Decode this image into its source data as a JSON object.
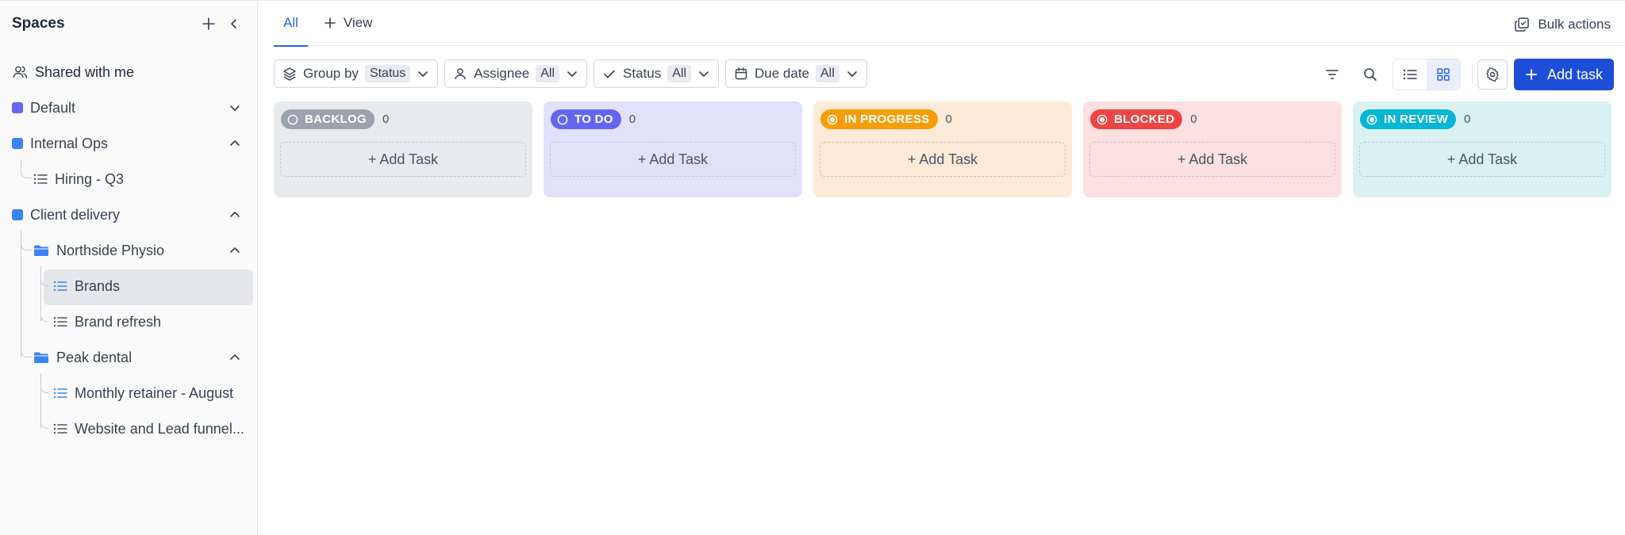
{
  "sidebar": {
    "title": "Spaces",
    "shared": "Shared with me",
    "spaces": [
      {
        "label": "Default",
        "color": "#6366f1"
      },
      {
        "label": "Internal Ops",
        "color": "#3b82f6"
      },
      {
        "label": "Client delivery",
        "color": "#3b82f6"
      }
    ],
    "hiring": "Hiring - Q3",
    "northside": "Northside Physio",
    "brands": "Brands",
    "brand_refresh": "Brand refresh",
    "peak": "Peak dental",
    "monthly": "Monthly retainer - August",
    "website": "Website and Lead funnel..."
  },
  "tabs": {
    "all": "All",
    "view": "View"
  },
  "bulk_actions": "Bulk actions",
  "filters": {
    "group_by": "Group by",
    "group_by_value": "Status",
    "assignee": "Assignee",
    "assignee_value": "All",
    "status": "Status",
    "status_value": "All",
    "due_date": "Due date",
    "due_date_value": "All"
  },
  "add_task": "Add task",
  "columns": [
    {
      "label": "BACKLOG",
      "count": "0",
      "add": "+ Add Task",
      "color": "#9ca3af",
      "bg": "#e8ebee"
    },
    {
      "label": "TO DO",
      "count": "0",
      "add": "+ Add Task",
      "color": "#6366f1",
      "bg": "#e2e1fb"
    },
    {
      "label": "IN PROGRESS",
      "count": "0",
      "add": "+ Add Task",
      "color": "#f59e0b",
      "bg": "#fdebd7"
    },
    {
      "label": "BLOCKED",
      "count": "0",
      "add": "+ Add Task",
      "color": "#ef4444",
      "bg": "#fde0e0"
    },
    {
      "label": "IN REVIEW",
      "count": "0",
      "add": "+ Add Task",
      "color": "#06b6d4",
      "bg": "#daf1f4"
    }
  ]
}
